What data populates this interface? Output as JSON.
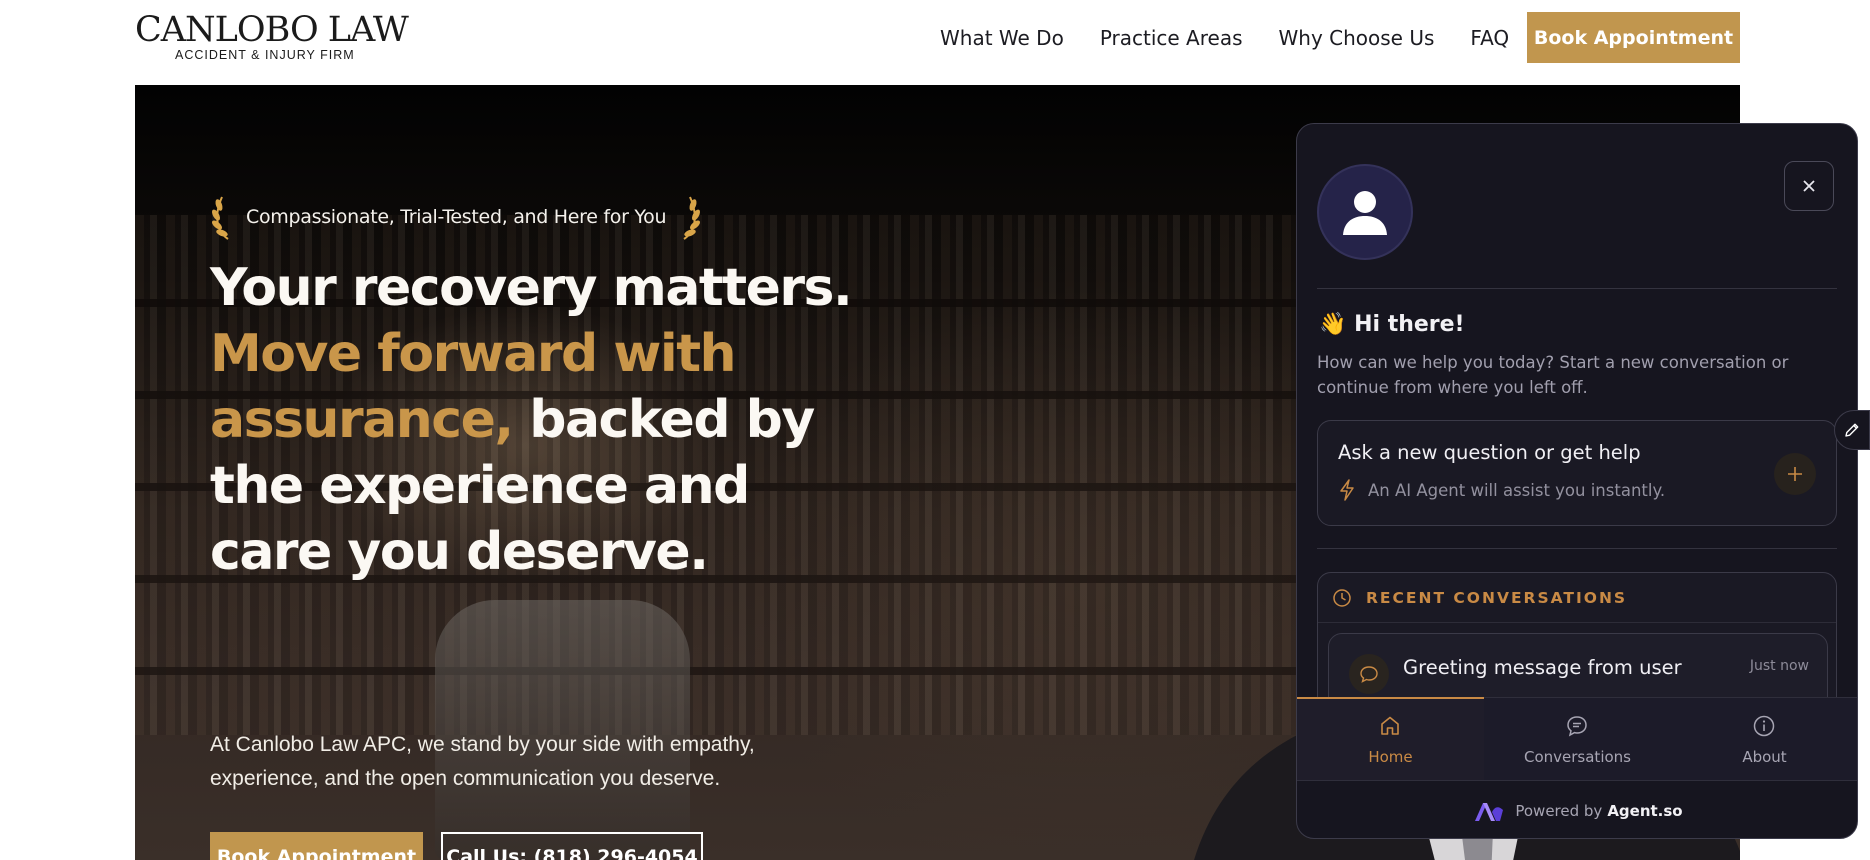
{
  "header": {
    "logo_main": "CANLOBO LAW",
    "logo_sub": "ACCIDENT & INJURY FIRM",
    "nav": [
      {
        "label": "What We Do"
      },
      {
        "label": "Practice Areas"
      },
      {
        "label": "Why Choose Us"
      },
      {
        "label": "FAQ"
      }
    ],
    "cta_label": "Book Appointment"
  },
  "hero": {
    "tagline": "Compassionate, Trial-Tested, and Here for You",
    "headline_line1": "Your recovery matters.",
    "headline_gold": "Move forward with assurance,",
    "headline_rest": "backed by the experience and care you deserve.",
    "body": "At Canlobo Law APC, we stand by your side with empathy, experience, and the open communication you deserve.",
    "book_label": "Book Appointment",
    "call_label": "Call Us: (818) 296-4054"
  },
  "chat": {
    "greeting_emoji": "👋",
    "greeting": "Hi there!",
    "subtitle": "How can we help you today? Start a new conversation or continue from where you left off.",
    "ask_title": "Ask a new question or get help",
    "ask_sub": "An AI Agent will assist you instantly.",
    "recent_title": "RECENT CONVERSATIONS",
    "recent": [
      {
        "title": "Greeting message from user",
        "time": "Just now"
      }
    ],
    "tabs": [
      {
        "label": "Home",
        "icon": "home-icon",
        "active": true
      },
      {
        "label": "Conversations",
        "icon": "chat-bubble-icon",
        "active": false
      },
      {
        "label": "About",
        "icon": "info-icon",
        "active": false
      }
    ],
    "powered_prefix": "Powered by",
    "powered_brand": "Agent.so"
  },
  "colors": {
    "brand_gold": "#c1964e",
    "chat_accent": "#c98a45",
    "chat_bg": "#16151f"
  }
}
